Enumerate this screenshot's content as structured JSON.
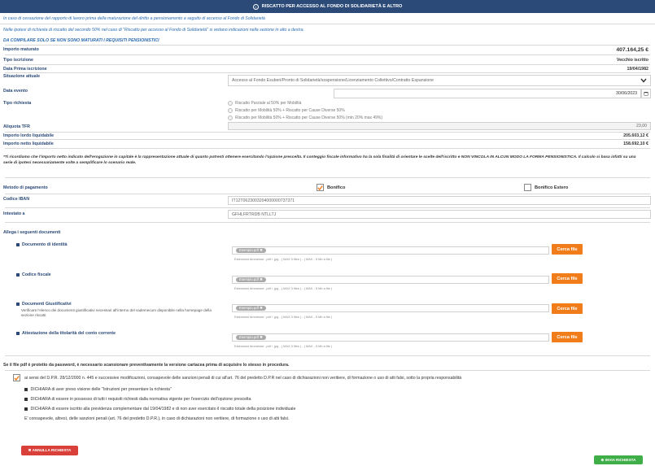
{
  "header": {
    "title": "RISCATTO PER ACCESSO AL FONDO DI SOLIDARIETÀ E ALTRO",
    "info_icon": "info-circle-icon"
  },
  "intro": {
    "line1": "In caso di cessazione del rapporto di lavoro prima della maturazione del diritto a pensionamento a seguito di accesso al Fondo di Solidarietà",
    "line2": "Nelle ipotesi di richiesta di riscatto del secondo 50% nel caso di \"Riscatto per accesso al Fondo di Solidarietà\" si vedano indicazioni nella sezione in alto a destra.",
    "section_title": "DA COMPILARE SOLO SE NON SONO MATURATI I REQUISITI PENSIONISTICI"
  },
  "fields": {
    "importo_maturato_label": "Importo maturato",
    "importo_maturato_value": "407.164,25 €",
    "tipo_iscrizione_label": "Tipo iscrizione",
    "tipo_iscrizione_value": "Vecchio iscritto",
    "data_prima_iscrizione_label": "Data Prima iscrizione",
    "data_prima_iscrizione_value": "19/04/1982",
    "situazione_attuale_label": "Situazione attuale",
    "situazione_attuale_value": "Accesso al Fondo Esuberi/Pronto di Solidarietà/sospensione/Licenziamento Collettivo/Contratto Espansione",
    "data_evento_label": "Data evento",
    "data_evento_value": "30/06/2023",
    "tipo_richiesta_label": "Tipo richiesta",
    "tipo_richiesta_options": [
      "Riscatto Parziale al 50% per Mobilità",
      "Riscatto per Mobilità 50% + Riscatto per Cause Diverse 50%",
      "Riscatto per Mobilità 50% + Riscatto per Cause Diverse 50% (min 20% max 49%)"
    ],
    "aliquota_label": "Aliquota TFR",
    "aliquota_value": "23,00",
    "importo_lordo_label": "Importo lordo liquidabile",
    "importo_lordo_value": "205.603,12 €",
    "importo_netto_label": "Importo netto liquidabile",
    "importo_netto_value": "158.692,10 €"
  },
  "disclaimer": "*Ti ricordiamo che l'importo netto indicato dell'erogazione in capitale è la rappresentazione attuale di quanto potresti ottenere esercitando l'opzione prescelta. Il conteggio fiscale informativo ha la sola finalità di orientare le scelte dell'iscritto e NON VINCOLA IN ALCUN MODO LA FORMA PENSIONISTICA. Il calcolo si basa infatti su una serie di ipotesi necessariamente volte a semplificare lo scenario reale.",
  "payment": {
    "label": "Metodo di pagamento",
    "option1": "Bonifico",
    "option2": "Bonifico Estero",
    "iban_label": "Codice IBAN",
    "iban_value": "IT12T0623003204000000737371",
    "intestato_label": "Intestato a",
    "intestato_value": "GFHLFRTRDB NTLLTJ"
  },
  "documents": {
    "title": "Allega i seguenti documenti",
    "chip_label": "Esempio.pdf ✖",
    "hint": "Estensioni Ammesse: .pdf / .jpg - ( MAX 3 files ) - ( MAX - 5 Mb a file )",
    "button_label": "Cerca file",
    "items": [
      {
        "label": "Documento di identità",
        "desc": ""
      },
      {
        "label": "Codice fiscale",
        "desc": ""
      },
      {
        "label": "Documenti Giustificativi",
        "desc": "Verificare l'elenco dei documenti giustificativi necessari all'interno del vademecum disponibile nella homepage della sezione riscatti"
      },
      {
        "label": "Attestazione della titolarità del conto corrente",
        "desc": ""
      }
    ]
  },
  "password_note": "Se il file pdf è protetto da password, è necessario scansionare preventivamente la versione cartacea prima di acquisire lo stesso in procedura.",
  "declaration": {
    "main": "ai sensi del D.P.R. 28/12/2000 n. 445 e successive modificazioni, consapevole delle sanzioni penali di cui all'art. 76 del predetto D.P.R nel caso di dichiarazioni non veritiere, di formazione o uso di atti falsi, sotto la propria responsabilità",
    "items": [
      "DICHIARA di aver preso visione delle \"Istruzioni per presentare la richiesta\"",
      "DICHIARA di essere in possesso di tutti i requisiti richiesti dalla normativa vigente per l'esercizio dell'opzione prescelta",
      "DICHIARA di essere iscritto alla previdenza complementare dal 19/04/1982 e di non aver esercitato il riscatto totale della posizione individuale"
    ],
    "footer": "E' consapevole, altresì, delle sanzioni penali (art. 76 del predetto D.P.R.), in caso di dichiarazioni non veritiere, di formazione o uso di atti falsi."
  },
  "actions": {
    "cancel": "✖ ANNULLA RICHIESTA",
    "submit": "⊕ INVIA RICHIESTA"
  },
  "colors": {
    "header": "#2b4a78",
    "accent_blue": "#2b6cb0",
    "orange": "#f07c1a",
    "red": "#d9403a",
    "green": "#3fae49"
  }
}
